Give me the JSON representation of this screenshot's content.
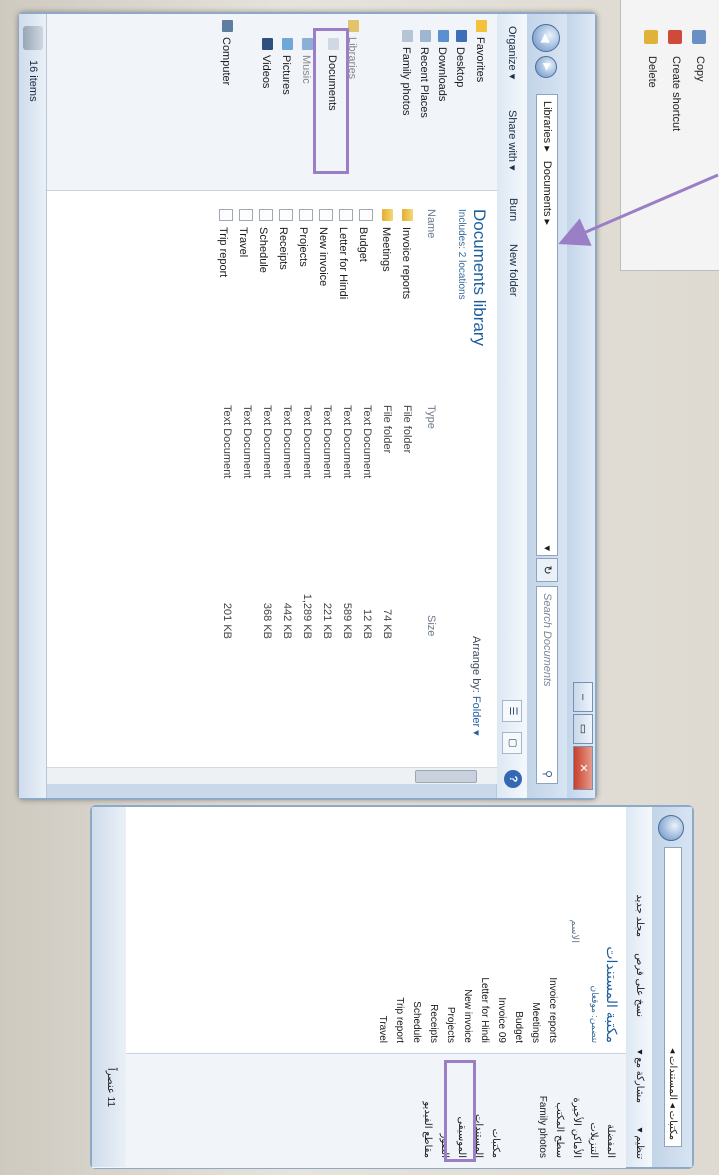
{
  "context_menu": {
    "items": [
      "Copy",
      "Create shortcut",
      "Delete"
    ]
  },
  "window": {
    "caption_buttons": {
      "minimize": "–",
      "maximize": "▭",
      "close": "✕"
    },
    "nav": {
      "back": "◀",
      "forward": "▶"
    },
    "address": {
      "segments": [
        "Libraries ▸",
        "Documents ▸"
      ],
      "dropdown": "▾"
    },
    "refresh": "↻",
    "search": {
      "placeholder": "Search Documents",
      "icon": "search-icon"
    },
    "toolbar": {
      "organize": "Organize ▾",
      "share_with": "Share with ▾",
      "burn": "Burn",
      "new_folder": "New folder",
      "help": "?"
    },
    "nav_pane": {
      "favorites": "Favorites",
      "desktop": "Desktop",
      "downloads": "Downloads",
      "recent_places": "Recent Places",
      "family_photos": "Family photos",
      "libraries": "Libraries",
      "documents": "Documents",
      "music": "Music",
      "pictures": "Pictures",
      "videos": "Videos",
      "computer": "Computer"
    },
    "library": {
      "title": "Documents library",
      "subtitle": "Includes: 2 locations",
      "arrange_label": "Arrange by:",
      "arrange_value": "Folder ▾"
    },
    "columns": {
      "name": "Name",
      "type": "Type",
      "size": "Size"
    },
    "files": [
      {
        "name": "Invoice reports",
        "type": "File folder",
        "size": "",
        "kind": "folder"
      },
      {
        "name": "Meetings",
        "type": "File folder",
        "size": "74 KB",
        "kind": "folder"
      },
      {
        "name": "Budget",
        "type": "Text Document",
        "size": "12 KB",
        "kind": "doc"
      },
      {
        "name": "Letter for Hindi",
        "type": "Text Document",
        "size": "589 KB",
        "kind": "doc"
      },
      {
        "name": "New invoice",
        "type": "Text Document",
        "size": "221 KB",
        "kind": "doc"
      },
      {
        "name": "Projects",
        "type": "Text Document",
        "size": "1,289 KB",
        "kind": "doc"
      },
      {
        "name": "Receipts",
        "type": "Text Document",
        "size": "442 KB",
        "kind": "doc"
      },
      {
        "name": "Schedule",
        "type": "Text Document",
        "size": "368 KB",
        "kind": "doc"
      },
      {
        "name": "Travel",
        "type": "Text Document",
        "size": "",
        "kind": "doc"
      },
      {
        "name": "Trip report",
        "type": "Text Document",
        "size": "201 KB",
        "kind": "doc"
      }
    ],
    "status": {
      "count": "16 items"
    }
  },
  "arabic_window": {
    "address": "مكتبات ◂ المستندات ◂",
    "toolbar": [
      "تنظيم ▾",
      "مشاركة مع ▾",
      "نسخ على قرص",
      "مجلد جديد"
    ],
    "library_title": "مكتبة المستندات",
    "library_subtitle": "تتضمن: موقعان",
    "column_name": "الاسم",
    "files": [
      "Invoice reports",
      "Meetings",
      "Budget",
      "Invoice 09",
      "Letter for Hindi",
      "New invoice",
      "Projects",
      "Receipts",
      "Schedule",
      "Trip report",
      "Travel"
    ],
    "nav_pane": [
      "المفضلة",
      "التنزيلات",
      "الأماكن الأخيرة",
      "سطح المكتب",
      "Family photos",
      "مكتبات",
      "المستندات",
      "الموسيقى",
      "الصور",
      "مقاطع الفيديو"
    ],
    "status": "11 عنصراً"
  },
  "colors": {
    "highlight": "#9b7fc6",
    "arrow": "#9b7fc6",
    "title_blue": "#1d5f9e",
    "frame": "#8ea9c6"
  }
}
